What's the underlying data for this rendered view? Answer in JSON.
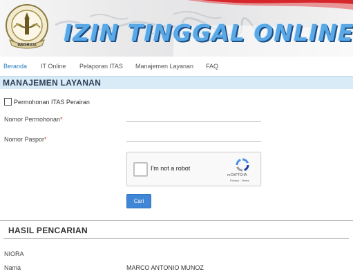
{
  "header": {
    "title": "IZIN TINGGAL ONLINE",
    "emblem_text": "IMIGRASI",
    "flag_colors": [
      "#d7262b",
      "#ffffff"
    ],
    "title_color": "#5aa9e6"
  },
  "nav": {
    "items": [
      {
        "label": "Beranda",
        "active": true
      },
      {
        "label": "IT Online",
        "active": false
      },
      {
        "label": "Pelaporan ITAS",
        "active": false
      },
      {
        "label": "Manajemen Layanan",
        "active": false
      },
      {
        "label": "FAQ",
        "active": false
      }
    ]
  },
  "section": {
    "title": "MANAJEMEN LAYANAN"
  },
  "form": {
    "checkbox_label": "Permohonan ITAS Perairan",
    "nomor_permohonan_label": "Nomor Permohonan",
    "nomor_paspor_label": "Nomor Paspor",
    "required_mark": "*",
    "nomor_permohonan_value": "",
    "nomor_paspor_value": "",
    "captcha": {
      "label": "I'm not a robot",
      "brand": "reCAPTCHA",
      "links": "Privacy - Terms"
    },
    "submit_label": "Cari",
    "accent_color": "#3f86d6"
  },
  "results": {
    "title": "HASIL PENCARIAN",
    "rows": [
      {
        "label": "NIORA",
        "value": ""
      },
      {
        "label": "Nama",
        "value": "MARCO ANTONIO MUNOZ"
      }
    ]
  }
}
